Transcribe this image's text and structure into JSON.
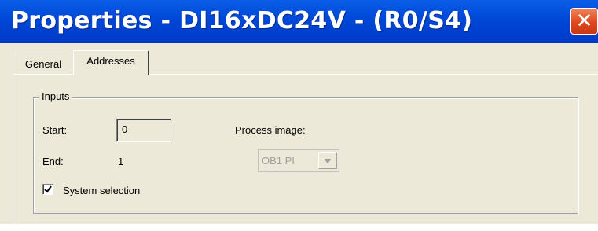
{
  "window": {
    "title": "Properties - DI16xDC24V - (R0/S4)",
    "close_glyph": "✕"
  },
  "tabs": [
    {
      "label": "General",
      "selected": false
    },
    {
      "label": "Addresses",
      "selected": true
    }
  ],
  "inputs_group": {
    "label": "Inputs",
    "start_label": "Start:",
    "start_value": "0",
    "end_label": "End:",
    "end_value": "1",
    "process_image_label": "Process image:",
    "process_image_value": "OB1 PI",
    "process_image_enabled": false,
    "system_selection_label": "System selection",
    "system_selection_checked": true
  },
  "colors": {
    "title_bar": "#0049d9",
    "close_button": "#e2471e",
    "dialog_face": "#ece9d8"
  }
}
